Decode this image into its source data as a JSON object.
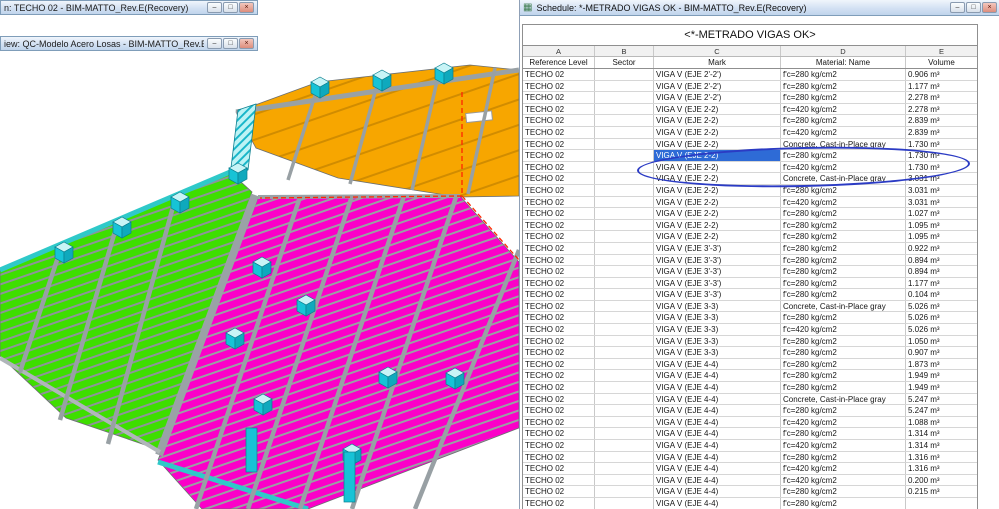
{
  "windows": {
    "plan_view": {
      "title": "n: TECHO 02 - BIM-MATTO_Rev.E(Recovery)"
    },
    "model_view": {
      "title": "iew: QC-Modelo Acero Losas - BIM-MATTO_Rev.E(Recovery)"
    },
    "schedule": {
      "title": "Schedule: *-METRADO VIGAS OK - BIM-MATTO_Rev.E(Recovery)"
    }
  },
  "window_buttons": {
    "minimize": "–",
    "restore": "□",
    "close": "×"
  },
  "schedule": {
    "table_title": "<*-METRADO VIGAS OK>",
    "column_letters": [
      "A",
      "B",
      "C",
      "D",
      "E"
    ],
    "columns": [
      "Reference Level",
      "Sector",
      "Mark",
      "Material: Name",
      "Volume"
    ],
    "selected": {
      "row_index": 7,
      "column": "Mark"
    },
    "rows": [
      [
        "TECHO 02",
        "",
        "VIGA V (EJE 2'-2')",
        "f'c=280 kg/cm2",
        "0.906 m³"
      ],
      [
        "TECHO 02",
        "",
        "VIGA V (EJE 2'-2')",
        "f'c=280 kg/cm2",
        "1.177 m³"
      ],
      [
        "TECHO 02",
        "",
        "VIGA V (EJE 2'-2')",
        "f'c=280 kg/cm2",
        "2.278 m³"
      ],
      [
        "TECHO 02",
        "",
        "VIGA V (EJE 2-2)",
        "f'c=420 kg/cm2",
        "2.278 m³"
      ],
      [
        "TECHO 02",
        "",
        "VIGA V (EJE 2-2)",
        "f'c=280 kg/cm2",
        "2.839 m³"
      ],
      [
        "TECHO 02",
        "",
        "VIGA V (EJE 2-2)",
        "f'c=420 kg/cm2",
        "2.839 m³"
      ],
      [
        "TECHO 02",
        "",
        "VIGA V (EJE 2-2)",
        "Concrete, Cast-in-Place gray",
        "1.730 m³"
      ],
      [
        "TECHO 02",
        "",
        "VIGA V (EJE 2-2)",
        "f'c=280 kg/cm2",
        "1.730 m³"
      ],
      [
        "TECHO 02",
        "",
        "VIGA V (EJE 2-2)",
        "f'c=420 kg/cm2",
        "1.730 m³"
      ],
      [
        "TECHO 02",
        "",
        "VIGA V (EJE 2-2)",
        "Concrete, Cast-in-Place gray",
        "3.031 m³"
      ],
      [
        "TECHO 02",
        "",
        "VIGA V (EJE 2-2)",
        "f'c=280 kg/cm2",
        "3.031 m³"
      ],
      [
        "TECHO 02",
        "",
        "VIGA V (EJE 2-2)",
        "f'c=420 kg/cm2",
        "3.031 m³"
      ],
      [
        "TECHO 02",
        "",
        "VIGA V (EJE 2-2)",
        "f'c=280 kg/cm2",
        "1.027 m³"
      ],
      [
        "TECHO 02",
        "",
        "VIGA V (EJE 2-2)",
        "f'c=280 kg/cm2",
        "1.095 m³"
      ],
      [
        "TECHO 02",
        "",
        "VIGA V (EJE 2-2)",
        "f'c=280 kg/cm2",
        "1.095 m³"
      ],
      [
        "TECHO 02",
        "",
        "VIGA V (EJE 3'-3')",
        "f'c=280 kg/cm2",
        "0.922 m³"
      ],
      [
        "TECHO 02",
        "",
        "VIGA V (EJE 3'-3')",
        "f'c=280 kg/cm2",
        "0.894 m³"
      ],
      [
        "TECHO 02",
        "",
        "VIGA V (EJE 3'-3')",
        "f'c=280 kg/cm2",
        "0.894 m³"
      ],
      [
        "TECHO 02",
        "",
        "VIGA V (EJE 3'-3')",
        "f'c=280 kg/cm2",
        "1.177 m³"
      ],
      [
        "TECHO 02",
        "",
        "VIGA V (EJE 3'-3')",
        "f'c=280 kg/cm2",
        "0.104 m³"
      ],
      [
        "TECHO 02",
        "",
        "VIGA V (EJE 3-3)",
        "Concrete, Cast-in-Place gray",
        "5.026 m³"
      ],
      [
        "TECHO 02",
        "",
        "VIGA V (EJE 3-3)",
        "f'c=280 kg/cm2",
        "5.026 m³"
      ],
      [
        "TECHO 02",
        "",
        "VIGA V (EJE 3-3)",
        "f'c=420 kg/cm2",
        "5.026 m³"
      ],
      [
        "TECHO 02",
        "",
        "VIGA V (EJE 3-3)",
        "f'c=280 kg/cm2",
        "1.050 m³"
      ],
      [
        "TECHO 02",
        "",
        "VIGA V (EJE 3-3)",
        "f'c=280 kg/cm2",
        "0.907 m³"
      ],
      [
        "TECHO 02",
        "",
        "VIGA V (EJE 4-4)",
        "f'c=280 kg/cm2",
        "1.873 m³"
      ],
      [
        "TECHO 02",
        "",
        "VIGA V (EJE 4-4)",
        "f'c=280 kg/cm2",
        "1.949 m³"
      ],
      [
        "TECHO 02",
        "",
        "VIGA V (EJE 4-4)",
        "f'c=280 kg/cm2",
        "1.949 m³"
      ],
      [
        "TECHO 02",
        "",
        "VIGA V (EJE 4-4)",
        "Concrete, Cast-in-Place gray",
        "5.247 m³"
      ],
      [
        "TECHO 02",
        "",
        "VIGA V (EJE 4-4)",
        "f'c=280 kg/cm2",
        "5.247 m³"
      ],
      [
        "TECHO 02",
        "",
        "VIGA V (EJE 4-4)",
        "f'c=420 kg/cm2",
        "1.088 m³"
      ],
      [
        "TECHO 02",
        "",
        "VIGA V (EJE 4-4)",
        "f'c=280 kg/cm2",
        "1.314 m³"
      ],
      [
        "TECHO 02",
        "",
        "VIGA V (EJE 4-4)",
        "f'c=420 kg/cm2",
        "1.314 m³"
      ],
      [
        "TECHO 02",
        "",
        "VIGA V (EJE 4-4)",
        "f'c=280 kg/cm2",
        "1.316 m³"
      ],
      [
        "TECHO 02",
        "",
        "VIGA V (EJE 4-4)",
        "f'c=420 kg/cm2",
        "1.316 m³"
      ],
      [
        "TECHO 02",
        "",
        "VIGA V (EJE 4-4)",
        "f'c=420 kg/cm2",
        "0.200 m³"
      ],
      [
        "TECHO 02",
        "",
        "VIGA V (EJE 4-4)",
        "f'c=280 kg/cm2",
        "0.215 m³"
      ],
      [
        "TECHO 02",
        "",
        "VIGA V (EJE 4-4)",
        "f'c=280 kg/cm2",
        ""
      ]
    ]
  },
  "viewport_3d": {
    "colors": {
      "orange_slab": "#f7a600",
      "green_slab": "#3ede00",
      "magenta_slab": "#fb00c8",
      "cyan_columns": "#17c3d6",
      "beam_gray": "#98a0a4",
      "selection_blue": "#2e6bd6",
      "annotation_blue": "#2b3bc4",
      "red_dashed_line": "#ff2600"
    }
  }
}
